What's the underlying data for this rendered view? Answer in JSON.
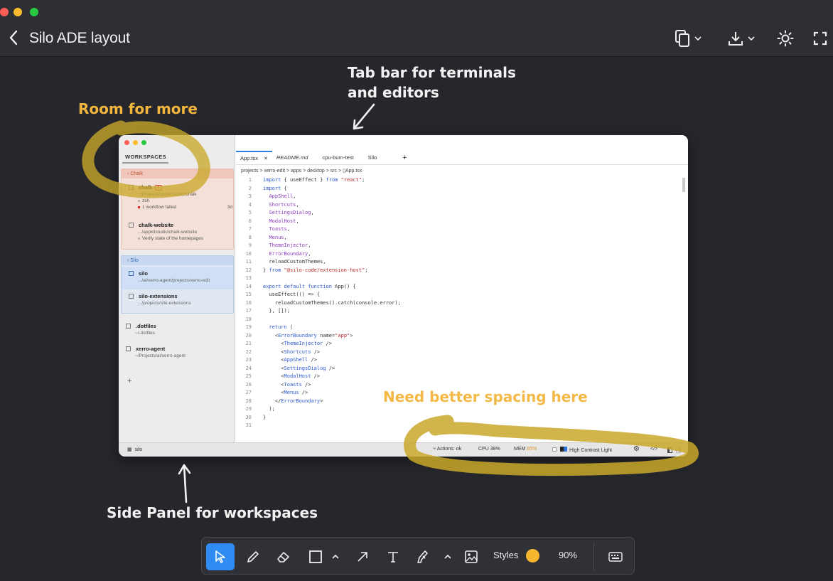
{
  "window": {
    "title": "Silo ADE layout"
  },
  "annotations": {
    "tab_bar_note_line1": "Tab bar for terminals",
    "tab_bar_note_line2": "and editors",
    "room_note": "Room for more",
    "spacing_note": "Need better spacing here",
    "side_panel_note": "Side Panel for workspaces"
  },
  "app": {
    "sidebar": {
      "header": "WORKSPACES",
      "groups": [
        {
          "name": "Chalk",
          "color": "#e79a86",
          "items": [
            {
              "name": "chalk",
              "badge": "1",
              "path": "~/Projects/appkitstudio/chalk",
              "meta1": "zsh",
              "meta2": "1 workflow failed",
              "age": "3d"
            },
            {
              "name": "chalk-website",
              "path": ".../appkitstudio/chalk-website",
              "meta1": "Verify state of the homepages"
            }
          ]
        },
        {
          "name": "Silo",
          "color": "#8cb2e2",
          "items": [
            {
              "name": "silo",
              "path": ".../ai/xerro-agent/projects/xerro-edit"
            },
            {
              "name": "silo-extensions",
              "path": ".../projects/silo-extensions"
            }
          ]
        }
      ],
      "loose": [
        {
          "name": ".dotfiles",
          "path": "~/.dotfiles"
        },
        {
          "name": "xerro-agent",
          "path": "~/Projects/ai/xerro-agent"
        }
      ],
      "add": "+"
    },
    "tabs": [
      {
        "label": "App.tsx",
        "close": "✕"
      },
      {
        "label": "README.md"
      },
      {
        "label": "cpu-burn-test"
      },
      {
        "label": "Silo"
      }
    ],
    "tab_add": "+",
    "breadcrumb": [
      "projects",
      "xerro-edit",
      "apps",
      "desktop",
      "src",
      "App.tsx"
    ],
    "code_lines": [
      "import { useEffect } from \"react\";",
      "import {",
      "  AppShell,",
      "  Shortcuts,",
      "  SettingsDialog,",
      "  ModalHost,",
      "  Toasts,",
      "  Menus,",
      "  ThemeInjector,",
      "  ErrorBoundary,",
      "  reloadCustomThemes,",
      "} from \"@silo-code/extension-host\";",
      "",
      "export default function App() {",
      "  useEffect(() => {",
      "    reloadCustomThemes().catch(console.error);",
      "  }, []);",
      "",
      "  return (",
      "    <ErrorBoundary name=\"app\">",
      "      <ThemeInjector />",
      "      <Shortcuts />",
      "      <AppShell />",
      "      <SettingsDialog />",
      "      <ModalHost />",
      "      <Toasts />",
      "      <Menus />",
      "    </ErrorBoundary>",
      "  );",
      "}",
      ""
    ],
    "status": {
      "workspace": "silo",
      "actions": "Actions: ok",
      "cpu": "CPU 38%",
      "mem_label": "MEM",
      "mem_value": "85%",
      "theme": "High Contrast Light"
    }
  },
  "toolbar": {
    "styles_label": "Styles",
    "zoom": "90%",
    "style_color": "#f7b62f"
  },
  "colors": {
    "accent": "#2f8cf2",
    "marker": "#c9a82a"
  }
}
